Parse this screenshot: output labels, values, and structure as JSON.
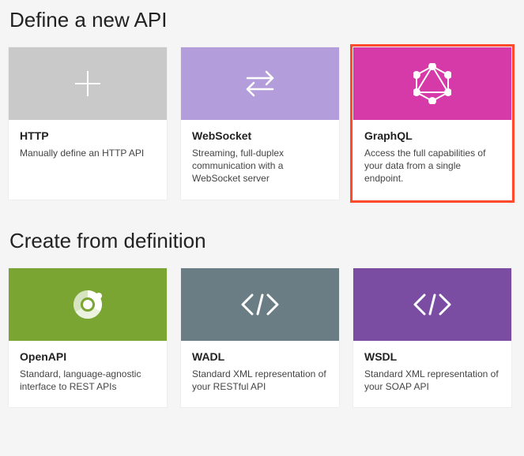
{
  "sections": {
    "define": {
      "title": "Define a new API",
      "cards": {
        "http": {
          "title": "HTTP",
          "desc": "Manually define an HTTP API"
        },
        "websocket": {
          "title": "WebSocket",
          "desc": "Streaming, full-duplex communication with a WebSocket server"
        },
        "graphql": {
          "title": "GraphQL",
          "desc": "Access the full capabilities of your data from a single endpoint."
        }
      }
    },
    "create": {
      "title": "Create from definition",
      "cards": {
        "openapi": {
          "title": "OpenAPI",
          "desc": "Standard, language-agnostic interface to REST APIs"
        },
        "wadl": {
          "title": "WADL",
          "desc": "Standard XML representation of your RESTful API"
        },
        "wsdl": {
          "title": "WSDL",
          "desc": "Standard XML representation of your SOAP API"
        }
      }
    }
  },
  "selected_card": "graphql",
  "colors": {
    "gray": "#c9c9c9",
    "lilac": "#b39ddb",
    "pink": "#d63aa8",
    "green": "#7aa533",
    "slate": "#6b7d84",
    "purple": "#7a4da3",
    "highlight": "#ff4b2b"
  }
}
